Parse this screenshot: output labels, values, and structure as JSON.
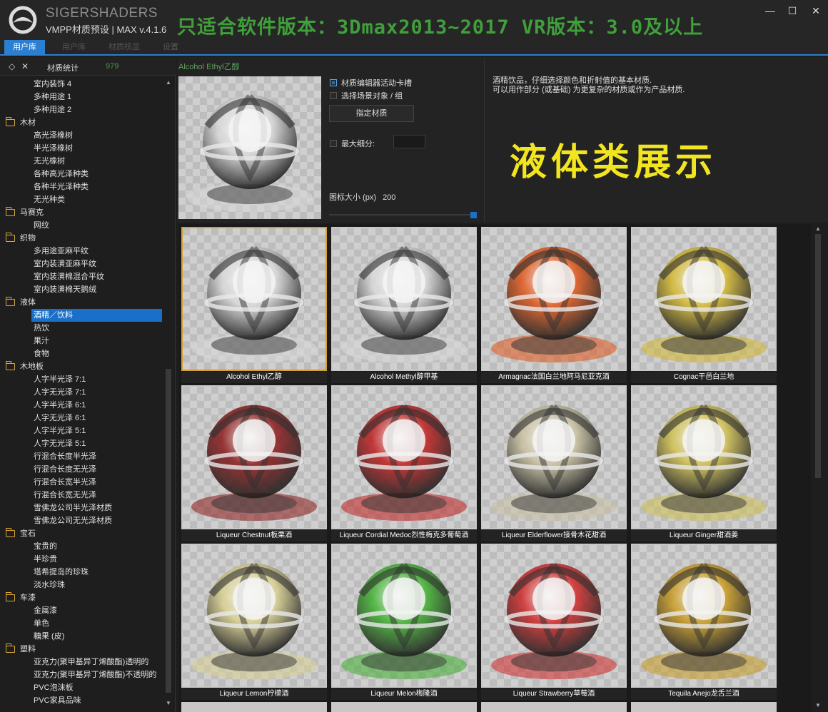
{
  "app": {
    "brand": "SIGERSHADERS",
    "subtitle": "VMPP材质预设 | MAX v.4.1.6",
    "banner": "只适合软件版本：3Dmax2013~2017  VR版本：3.0及以上"
  },
  "window_controls": {
    "minimize": "—",
    "maximize": "☐",
    "close": "✕"
  },
  "tabs": [
    {
      "label": "用户库",
      "active": true
    },
    {
      "label": "用户库",
      "active": false
    },
    {
      "label": "材质核显",
      "active": false
    },
    {
      "label": "设置",
      "active": false
    }
  ],
  "sidebar": {
    "header_icon_1": "◇",
    "header_icon_2": "✕",
    "header_label": "材质统计",
    "header_count": "979",
    "tree": [
      {
        "kind": "item",
        "label": "室内装饰 4"
      },
      {
        "kind": "item",
        "label": "多种用途 1"
      },
      {
        "kind": "item",
        "label": "多种用途 2"
      },
      {
        "kind": "cat",
        "label": "木材"
      },
      {
        "kind": "item",
        "label": "高光泽橡树"
      },
      {
        "kind": "item",
        "label": "半光泽橡树"
      },
      {
        "kind": "item",
        "label": "无光橡树"
      },
      {
        "kind": "item",
        "label": "各种高光泽种类"
      },
      {
        "kind": "item",
        "label": "各种半光泽种类"
      },
      {
        "kind": "item",
        "label": "无光种类"
      },
      {
        "kind": "cat",
        "label": "马赛克"
      },
      {
        "kind": "item",
        "label": "网纹"
      },
      {
        "kind": "cat",
        "label": "织物"
      },
      {
        "kind": "item",
        "label": "多用途亚麻平纹"
      },
      {
        "kind": "item",
        "label": "室内装潢亚麻平纹"
      },
      {
        "kind": "item",
        "label": "室内装潢棉混合平纹"
      },
      {
        "kind": "item",
        "label": "室内装潢棉天鹅绒"
      },
      {
        "kind": "cat",
        "label": "液体"
      },
      {
        "kind": "item",
        "label": "酒精／饮料",
        "selected": true
      },
      {
        "kind": "item",
        "label": "热饮"
      },
      {
        "kind": "item",
        "label": "果汁"
      },
      {
        "kind": "item",
        "label": "食物"
      },
      {
        "kind": "cat",
        "label": "木地板"
      },
      {
        "kind": "item",
        "label": "人字半光泽 7:1"
      },
      {
        "kind": "item",
        "label": "人字无光泽 7:1"
      },
      {
        "kind": "item",
        "label": "人字半光泽 6:1"
      },
      {
        "kind": "item",
        "label": "人字无光泽 6:1"
      },
      {
        "kind": "item",
        "label": "人字半光泽 5:1"
      },
      {
        "kind": "item",
        "label": "人字无光泽 5:1"
      },
      {
        "kind": "item",
        "label": "行混合长度半光泽"
      },
      {
        "kind": "item",
        "label": "行混合长度无光泽"
      },
      {
        "kind": "item",
        "label": "行混合长宽半光泽"
      },
      {
        "kind": "item",
        "label": "行混合长宽无光泽"
      },
      {
        "kind": "item",
        "label": "雪佛龙公司半光泽材质"
      },
      {
        "kind": "item",
        "label": "雪佛龙公司无光泽材质"
      },
      {
        "kind": "cat",
        "label": "宝石"
      },
      {
        "kind": "item",
        "label": "宝贵的"
      },
      {
        "kind": "item",
        "label": "半珍贵"
      },
      {
        "kind": "item",
        "label": "塔希提岛的珍珠"
      },
      {
        "kind": "item",
        "label": "淡水珍珠"
      },
      {
        "kind": "cat",
        "label": "车漆"
      },
      {
        "kind": "item",
        "label": "金属漆"
      },
      {
        "kind": "item",
        "label": "单色"
      },
      {
        "kind": "item",
        "label": "糖果 (皮)"
      },
      {
        "kind": "cat",
        "label": "塑料"
      },
      {
        "kind": "item",
        "label": "亚克力(聚甲基异丁烯酸酯)透明的"
      },
      {
        "kind": "item",
        "label": "亚克力(聚甲基异丁烯酸酯)不透明的"
      },
      {
        "kind": "item",
        "label": "PVC泡沫板"
      },
      {
        "kind": "item",
        "label": "PVC家具品味"
      }
    ]
  },
  "detail": {
    "title": "Alcohol Ethyl乙醇",
    "option_editor_slot": "材质编辑器活动卡槽",
    "option_select_scene": "选择场景对象 / 组",
    "assign_button": "指定材质",
    "max_subdiv_label": "最大细分:",
    "icon_size_label": "图标大小 (px)",
    "icon_size_value": "200",
    "icon_size_fraction": 1.0,
    "description_line1": "酒精饮品，仔细选择颜色和折射值的基本材质.",
    "description_line2": "可以用作部分 (或基础) 为更复杂的材质或作为产品材质.",
    "showcase_text": "液体类展示"
  },
  "grid": {
    "tiles": [
      {
        "caption": "Alcohol Ethyl乙醇",
        "color": "#d8d8d8",
        "selected": true
      },
      {
        "caption": "Alcohol Methyl醇甲基",
        "color": "#d8d8d8"
      },
      {
        "caption": "Armagnac法国白兰地阿马尼亚克酒",
        "color": "#e0561a"
      },
      {
        "caption": "Cognac干邑白兰地",
        "color": "#d4b830"
      },
      {
        "caption": "Liqueur Chestnut板栗酒",
        "color": "#8c1a1a"
      },
      {
        "caption": "Liqueur Cordial Medoc烈性梅克多葡萄酒",
        "color": "#c01e1e"
      },
      {
        "caption": "Liqueur Elderflower接骨木花甜酒",
        "color": "#c8c0a0"
      },
      {
        "caption": "Liqueur Ginger甜酒姜",
        "color": "#d0c050"
      },
      {
        "caption": "Liqueur Lemon柠檬酒",
        "color": "#d8d090"
      },
      {
        "caption": "Liqueur Melon梅隆酒",
        "color": "#40b030"
      },
      {
        "caption": "Liqueur Strawberry草莓酒",
        "color": "#d02828"
      },
      {
        "caption": "Tequila Anejo龙舌兰酒",
        "color": "#c89a20"
      }
    ]
  }
}
